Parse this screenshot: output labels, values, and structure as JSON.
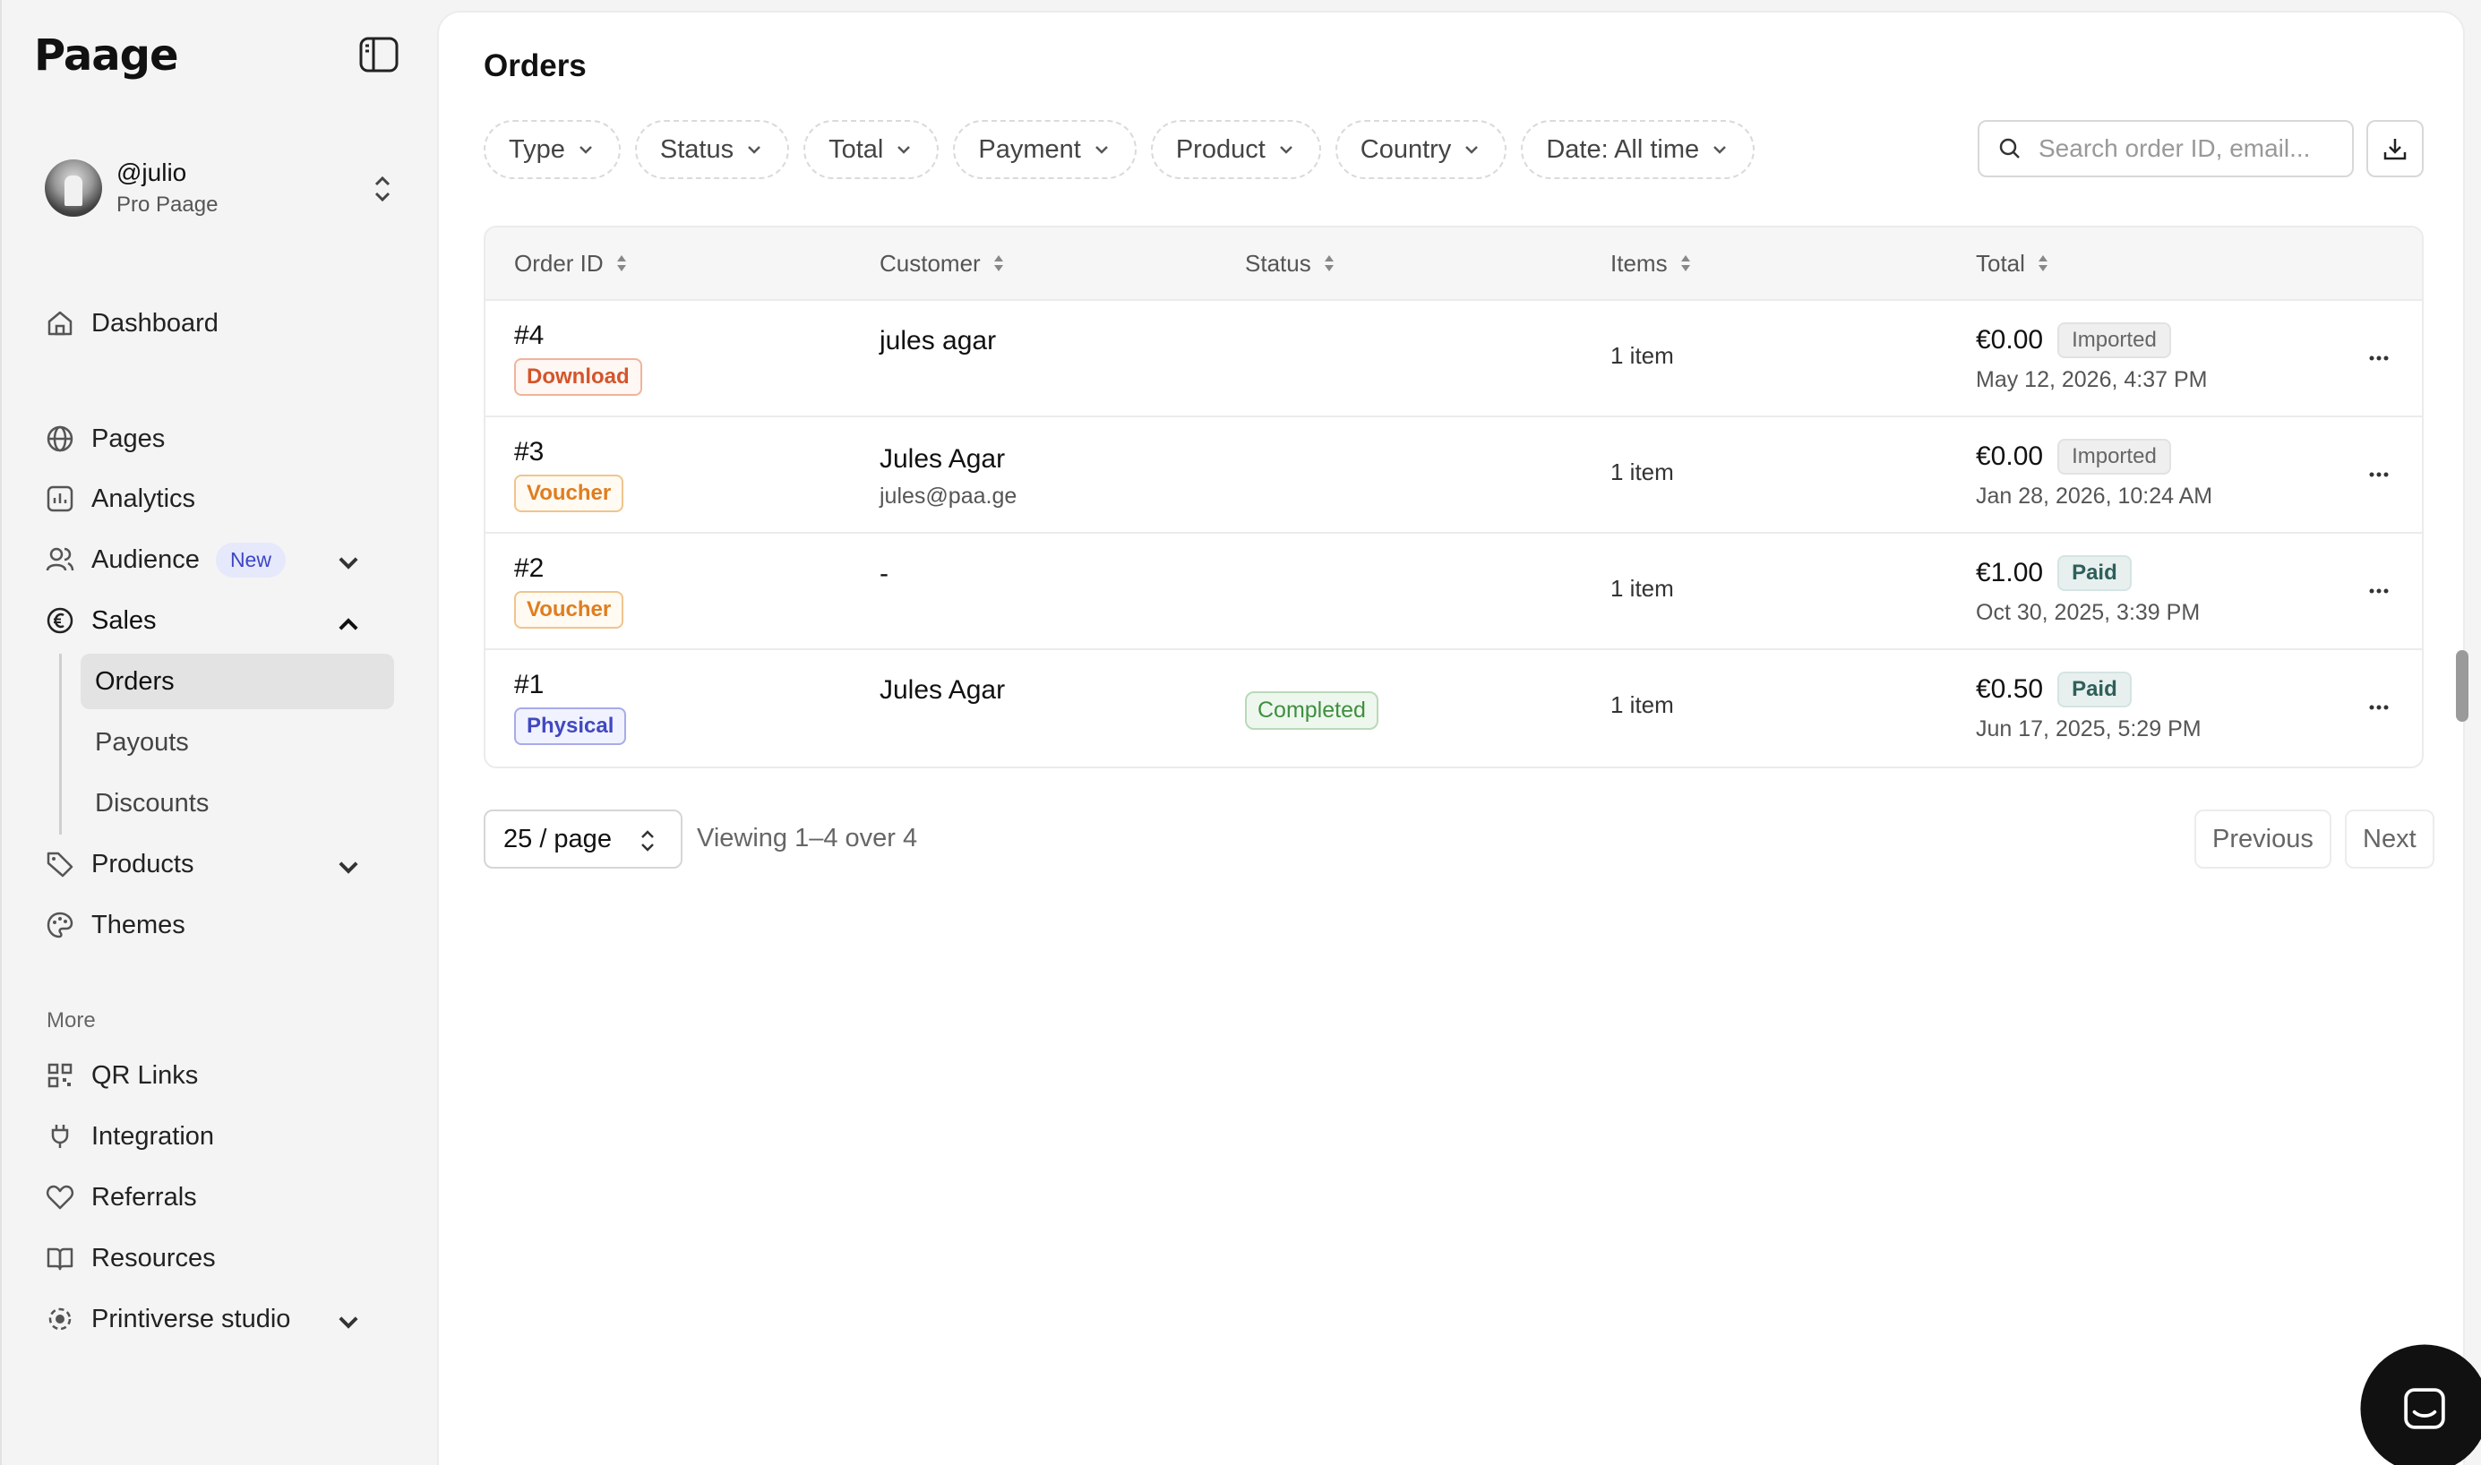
{
  "app": {
    "logo": "Paage"
  },
  "user": {
    "name": "@julio",
    "plan": "Pro Paage"
  },
  "nav": {
    "dashboard": "Dashboard",
    "pages": "Pages",
    "analytics": "Analytics",
    "audience": "Audience",
    "audience_badge": "New",
    "sales": "Sales",
    "sales_sub": [
      "Orders",
      "Payouts",
      "Discounts"
    ],
    "products": "Products",
    "themes": "Themes",
    "more_label": "More",
    "qr_links": "QR Links",
    "integration": "Integration",
    "referrals": "Referrals",
    "resources": "Resources",
    "printiverse": "Printiverse studio"
  },
  "main": {
    "title": "Orders",
    "filters": [
      "Type",
      "Status",
      "Total",
      "Payment",
      "Product",
      "Country",
      "Date: All time"
    ],
    "search_placeholder": "Search order ID, email...",
    "columns": [
      "Order ID",
      "Customer",
      "Status",
      "Items",
      "Total"
    ],
    "rows": [
      {
        "id": "#4",
        "type": "Download",
        "customer": "jules agar",
        "email": "",
        "status": "",
        "items": "1 item",
        "total": "€0.00",
        "payment": "Imported",
        "date": "May 12, 2026, 4:37 PM"
      },
      {
        "id": "#3",
        "type": "Voucher",
        "customer": "Jules Agar",
        "email": "jules@paa.ge",
        "status": "",
        "items": "1 item",
        "total": "€0.00",
        "payment": "Imported",
        "date": "Jan 28, 2026, 10:24 AM"
      },
      {
        "id": "#2",
        "type": "Voucher",
        "customer": "-",
        "email": "",
        "status": "",
        "items": "1 item",
        "total": "€1.00",
        "payment": "Paid",
        "date": "Oct 30, 2025, 3:39 PM"
      },
      {
        "id": "#1",
        "type": "Physical",
        "customer": "Jules Agar",
        "email": "",
        "status": "Completed",
        "items": "1 item",
        "total": "€0.50",
        "payment": "Paid",
        "date": "Jun 17, 2025, 5:29 PM"
      }
    ],
    "pager": {
      "per_page": "25 / page",
      "viewing": "Viewing 1–4 over 4",
      "previous": "Previous",
      "next": "Next"
    }
  },
  "colors": {
    "accent_orange": "#d4552b",
    "voucher": "#e07d1f",
    "physical": "#4148c0",
    "completed": "#3f8f3f",
    "paid": "#2f5f5a"
  }
}
